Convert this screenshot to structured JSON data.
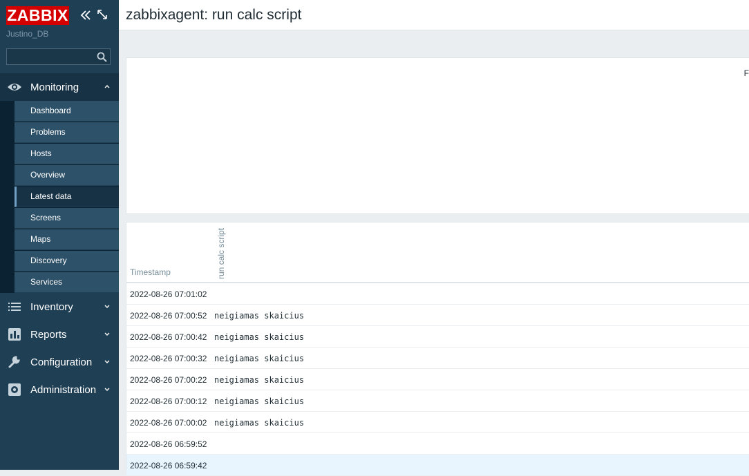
{
  "sidebar": {
    "logo": "ZABBIX",
    "server_name": "Justino_DB",
    "search": {
      "value": "",
      "placeholder": ""
    },
    "menu": [
      {
        "label": "Monitoring",
        "icon": "eye-icon",
        "expanded": true
      },
      {
        "label": "Inventory",
        "icon": "list-icon"
      },
      {
        "label": "Reports",
        "icon": "bar-chart-icon"
      },
      {
        "label": "Configuration",
        "icon": "wrench-icon"
      },
      {
        "label": "Administration",
        "icon": "gear-icon"
      }
    ],
    "monitoring_items": [
      {
        "label": "Dashboard"
      },
      {
        "label": "Problems"
      },
      {
        "label": "Hosts"
      },
      {
        "label": "Overview"
      },
      {
        "label": "Latest data",
        "selected": true
      },
      {
        "label": "Screens"
      },
      {
        "label": "Maps"
      },
      {
        "label": "Discovery"
      },
      {
        "label": "Services"
      }
    ]
  },
  "header": {
    "title": "zabbixagent: run calc script"
  },
  "graph": {
    "edge_text": "F"
  },
  "table": {
    "columns": [
      "Timestamp",
      "run calc script"
    ],
    "rows": [
      {
        "timestamp": "2022-08-26 07:01:02",
        "value": ""
      },
      {
        "timestamp": "2022-08-26 07:00:52",
        "value": "neigiamas skaicius"
      },
      {
        "timestamp": "2022-08-26 07:00:42",
        "value": "neigiamas skaicius"
      },
      {
        "timestamp": "2022-08-26 07:00:32",
        "value": "neigiamas skaicius"
      },
      {
        "timestamp": "2022-08-26 07:00:22",
        "value": "neigiamas skaicius"
      },
      {
        "timestamp": "2022-08-26 07:00:12",
        "value": "neigiamas skaicius"
      },
      {
        "timestamp": "2022-08-26 07:00:02",
        "value": "neigiamas skaicius"
      },
      {
        "timestamp": "2022-08-26 06:59:52",
        "value": ""
      },
      {
        "timestamp": "2022-08-26 06:59:42",
        "value": ""
      }
    ]
  },
  "colors": {
    "sidebar_bg": "#1f3f55",
    "logo_red": "#d40000",
    "submenu_bg": "#2d5169",
    "highlight_row": "#e8f5ff"
  }
}
